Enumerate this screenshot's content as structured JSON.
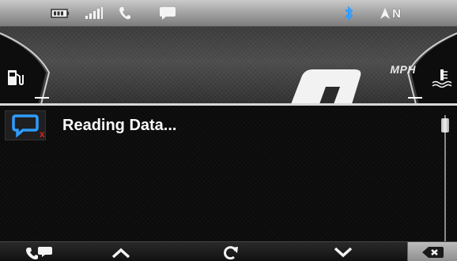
{
  "status_bar": {
    "battery_icon": "battery-icon",
    "signal_icon": "signal-bars-icon",
    "phone_icon": "phone-icon",
    "message_icon": "message-bubble-icon",
    "bluetooth_icon": "bluetooth-icon",
    "compass_heading": "N",
    "colors": {
      "bar": "#a8a8a8",
      "bluetooth": "#3aa0ff"
    }
  },
  "gauge": {
    "speed_unit": "MPH",
    "fuel_icon": "fuel-pump-icon",
    "temp_icon": "coolant-temperature-icon"
  },
  "message_panel": {
    "icon": "message-error-icon",
    "title": "Reading Data...",
    "colors": {
      "icon_blue": "#2e9cff",
      "icon_x": "#e0221c"
    }
  },
  "nav": {
    "call_icon": "call-message-icon",
    "up_icon": "chevron-up-icon",
    "refresh_icon": "refresh-icon",
    "down_icon": "chevron-down-icon",
    "clear_icon": "backspace-clear-icon"
  }
}
